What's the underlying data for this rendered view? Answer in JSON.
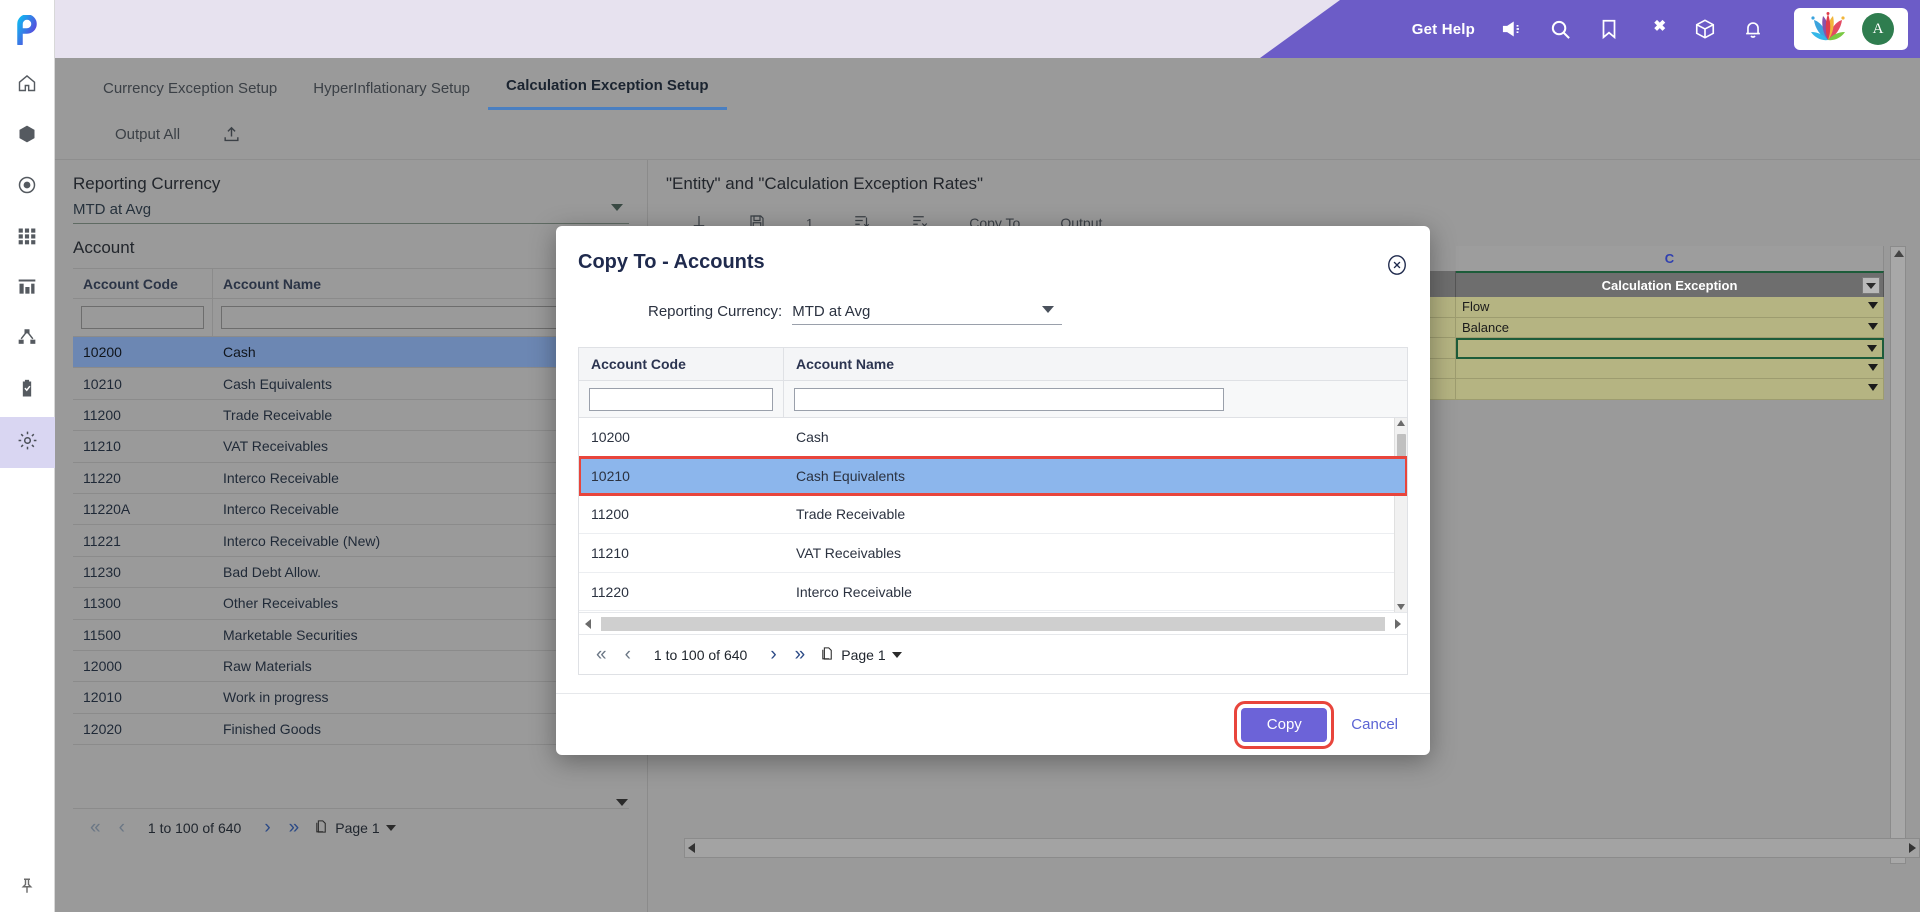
{
  "header": {
    "get_help": "Get Help",
    "icons": [
      "megaphone-icon",
      "search-icon",
      "bookmark-icon",
      "puzzle-icon",
      "box-icon",
      "bell-icon"
    ],
    "avatar_initial": "A",
    "accent_purple": "#6c5cc7"
  },
  "rail": {
    "logo": "p-logo-icon",
    "items": [
      {
        "name": "home-icon"
      },
      {
        "name": "cube-icon"
      },
      {
        "name": "target-icon"
      },
      {
        "name": "grid-icon"
      },
      {
        "name": "chart-icon"
      },
      {
        "name": "hierarchy-icon"
      },
      {
        "name": "clipboard-check-icon"
      },
      {
        "name": "gear-icon",
        "active": true
      }
    ],
    "pin": "pin-icon"
  },
  "tabs": [
    {
      "label": "Currency Exception Setup",
      "active": false
    },
    {
      "label": "HyperInflationary Setup",
      "active": false
    },
    {
      "label": "Calculation Exception Setup",
      "active": true
    }
  ],
  "subbar": {
    "output_all": "Output All",
    "upload_icon": "upload-icon"
  },
  "left_panel": {
    "currency_label": "Reporting Currency",
    "currency_value": "MTD at Avg",
    "account_label": "Account",
    "columns": [
      "Account Code",
      "Account Name"
    ],
    "filter_code": "",
    "filter_name": "",
    "rows": [
      {
        "code": "10200",
        "name": "Cash",
        "selected": true
      },
      {
        "code": "10210",
        "name": "Cash Equivalents",
        "selected": false
      },
      {
        "code": "11200",
        "name": "Trade Receivable",
        "selected": false
      },
      {
        "code": "11210",
        "name": "VAT Receivables",
        "selected": false
      },
      {
        "code": "11220",
        "name": "Interco Receivable",
        "selected": false
      },
      {
        "code": "11220A",
        "name": "Interco Receivable",
        "selected": false
      },
      {
        "code": "11221",
        "name": "Interco Receivable (New)",
        "selected": false
      },
      {
        "code": "11230",
        "name": "Bad Debt Allow.",
        "selected": false
      },
      {
        "code": "11300",
        "name": "Other Receivables",
        "selected": false
      },
      {
        "code": "11500",
        "name": "Marketable Securities",
        "selected": false
      },
      {
        "code": "12000",
        "name": "Raw Materials",
        "selected": false
      },
      {
        "code": "12010",
        "name": "Work in progress",
        "selected": false
      },
      {
        "code": "12020",
        "name": "Finished Goods",
        "selected": false
      }
    ],
    "pager": {
      "first": "«",
      "prev": "‹",
      "range": "1 to 100 of 640",
      "next": "›",
      "last": "»",
      "page_icon": "pages-icon",
      "page_label": "Page 1"
    }
  },
  "right_panel": {
    "title": "\"Entity\" and \"Calculation Exception Rates\"",
    "column_letter": "C",
    "grid_header": "Calculation Exception",
    "cells": [
      {
        "value": "Flow",
        "active": false
      },
      {
        "value": "Balance",
        "active": false
      },
      {
        "value": "",
        "active": true
      },
      {
        "value": "",
        "active": false
      },
      {
        "value": "",
        "active": false
      }
    ]
  },
  "modal": {
    "title": "Copy To - Accounts",
    "close_icon": "close-icon",
    "currency_label": "Reporting Currency:",
    "currency_value": "MTD at Avg",
    "columns": [
      "Account Code",
      "Account Name"
    ],
    "filter_code": "",
    "filter_name": "",
    "rows": [
      {
        "code": "10200",
        "name": "Cash",
        "selected": false,
        "highlight": false
      },
      {
        "code": "10210",
        "name": "Cash Equivalents",
        "selected": true,
        "highlight": true
      },
      {
        "code": "11200",
        "name": "Trade Receivable",
        "selected": false,
        "highlight": false
      },
      {
        "code": "11210",
        "name": "VAT Receivables",
        "selected": false,
        "highlight": false
      },
      {
        "code": "11220",
        "name": "Interco Receivable",
        "selected": false,
        "highlight": false
      }
    ],
    "pager": {
      "first": "«",
      "prev": "‹",
      "range": "1 to 100 of 640",
      "next": "›",
      "last": "»",
      "page_icon": "pages-icon",
      "page_label": "Page 1"
    },
    "copy_label": "Copy",
    "cancel_label": "Cancel",
    "copy_color": "#6c63d8",
    "highlight_color": "#e8453c"
  }
}
